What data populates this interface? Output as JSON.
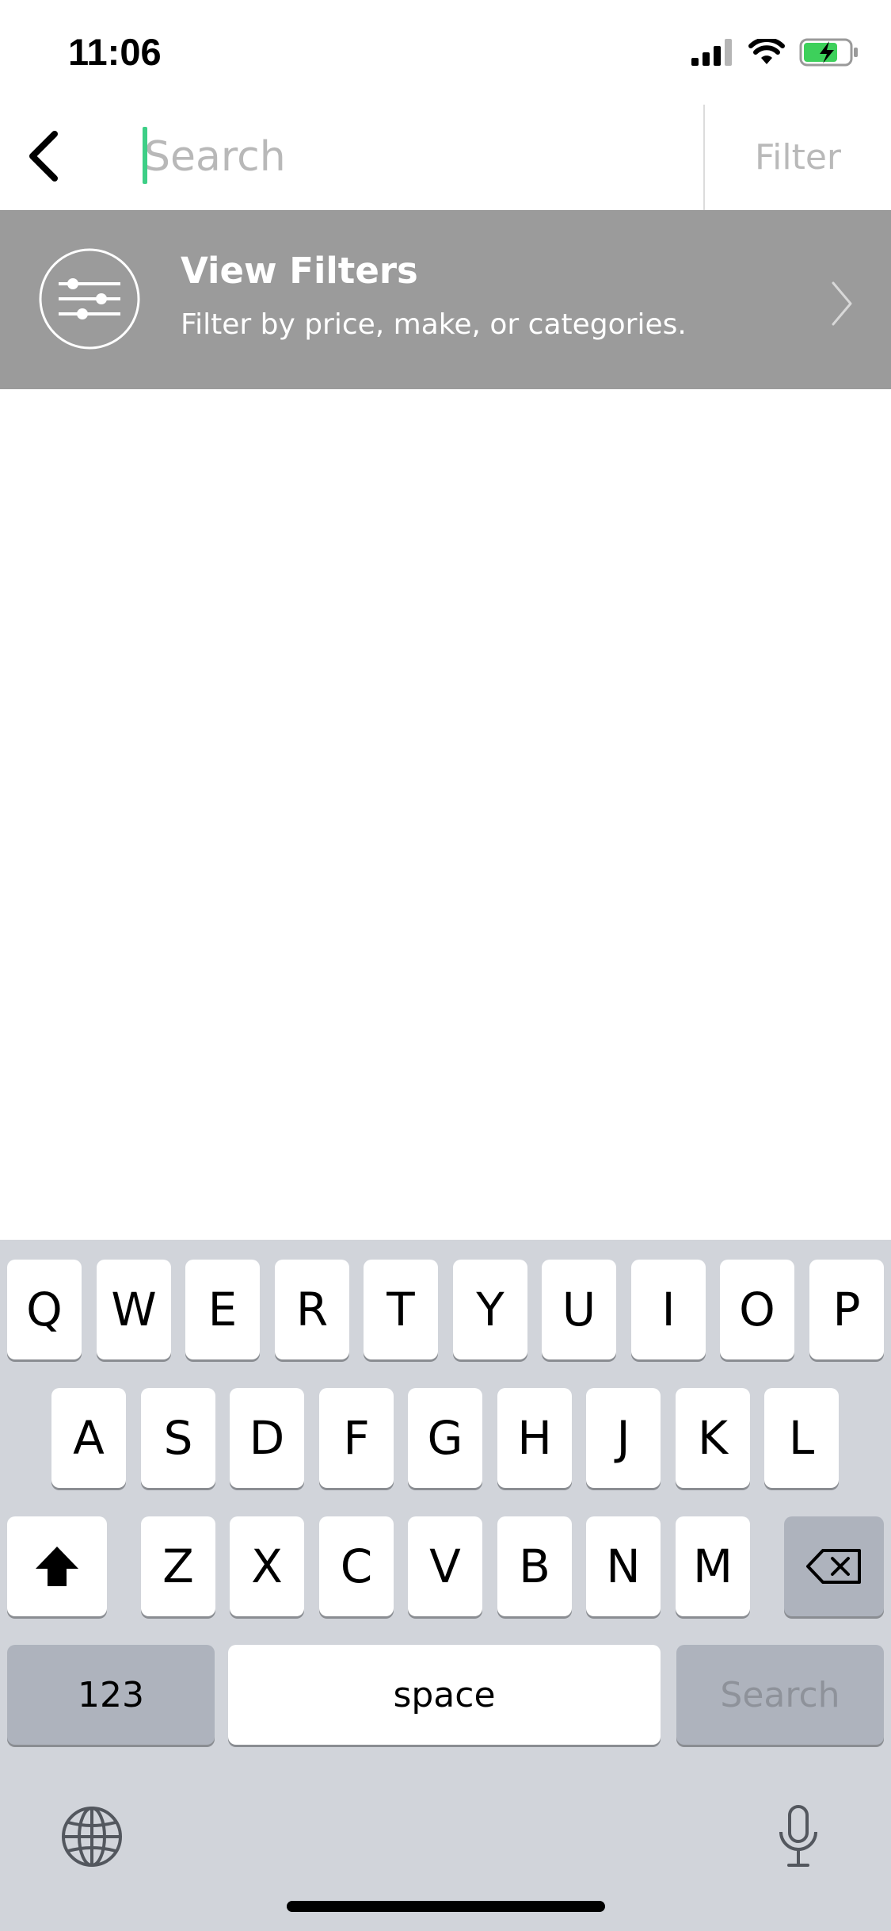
{
  "status": {
    "time": "11:06"
  },
  "header": {
    "search_placeholder": "Search",
    "filter_label": "Filter"
  },
  "filter_row": {
    "title": "View Filters",
    "subtitle": "Filter by price, make, or categories."
  },
  "keyboard": {
    "row1": [
      "Q",
      "W",
      "E",
      "R",
      "T",
      "Y",
      "U",
      "I",
      "O",
      "P"
    ],
    "row2": [
      "A",
      "S",
      "D",
      "F",
      "G",
      "H",
      "J",
      "K",
      "L"
    ],
    "row3": [
      "Z",
      "X",
      "C",
      "V",
      "B",
      "N",
      "M"
    ],
    "numbers_label": "123",
    "space_label": "space",
    "return_label": "Search"
  },
  "colors": {
    "accent": "#3dcf86",
    "filter_bar": "#9b9b9b",
    "keyboard_bg": "#d1d4da"
  },
  "icons": [
    "signal-icon",
    "wifi-icon",
    "battery-charging-icon",
    "back-chevron-icon",
    "sliders-icon",
    "chevron-right-icon",
    "shift-icon",
    "delete-icon",
    "globe-icon",
    "microphone-icon"
  ]
}
